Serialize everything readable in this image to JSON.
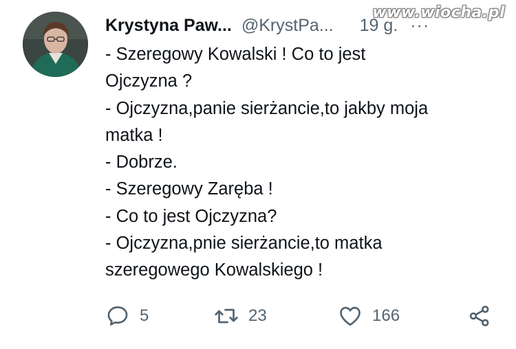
{
  "header": {
    "display_name": "Krystyna Paw...",
    "handle": "@KrystPa...",
    "time": "19 g.",
    "more": "···"
  },
  "watermark": "www.wiocha.pl",
  "tweet": {
    "lines": [
      "- Szeregowy Kowalski ! Co to jest",
      "Ojczyzna ?",
      "- Ojczyzna,panie sierżancie,to jakby moja",
      "matka !",
      "- Dobrze.",
      "- Szeregowy Zaręba !",
      "- Co to jest Ojczyzna?",
      "- Ojczyzna,pnie sierżancie,to matka",
      "szeregowego Kowalskiego !"
    ]
  },
  "actions": {
    "reply_icon": "reply-icon",
    "reply_count": "5",
    "retweet_icon": "retweet-icon",
    "retweet_count": "23",
    "like_icon": "heart-icon",
    "like_count": "166",
    "share_icon": "share-icon"
  },
  "colors": {
    "text": "#0f1419",
    "secondary": "#536471",
    "background": "#ffffff"
  }
}
